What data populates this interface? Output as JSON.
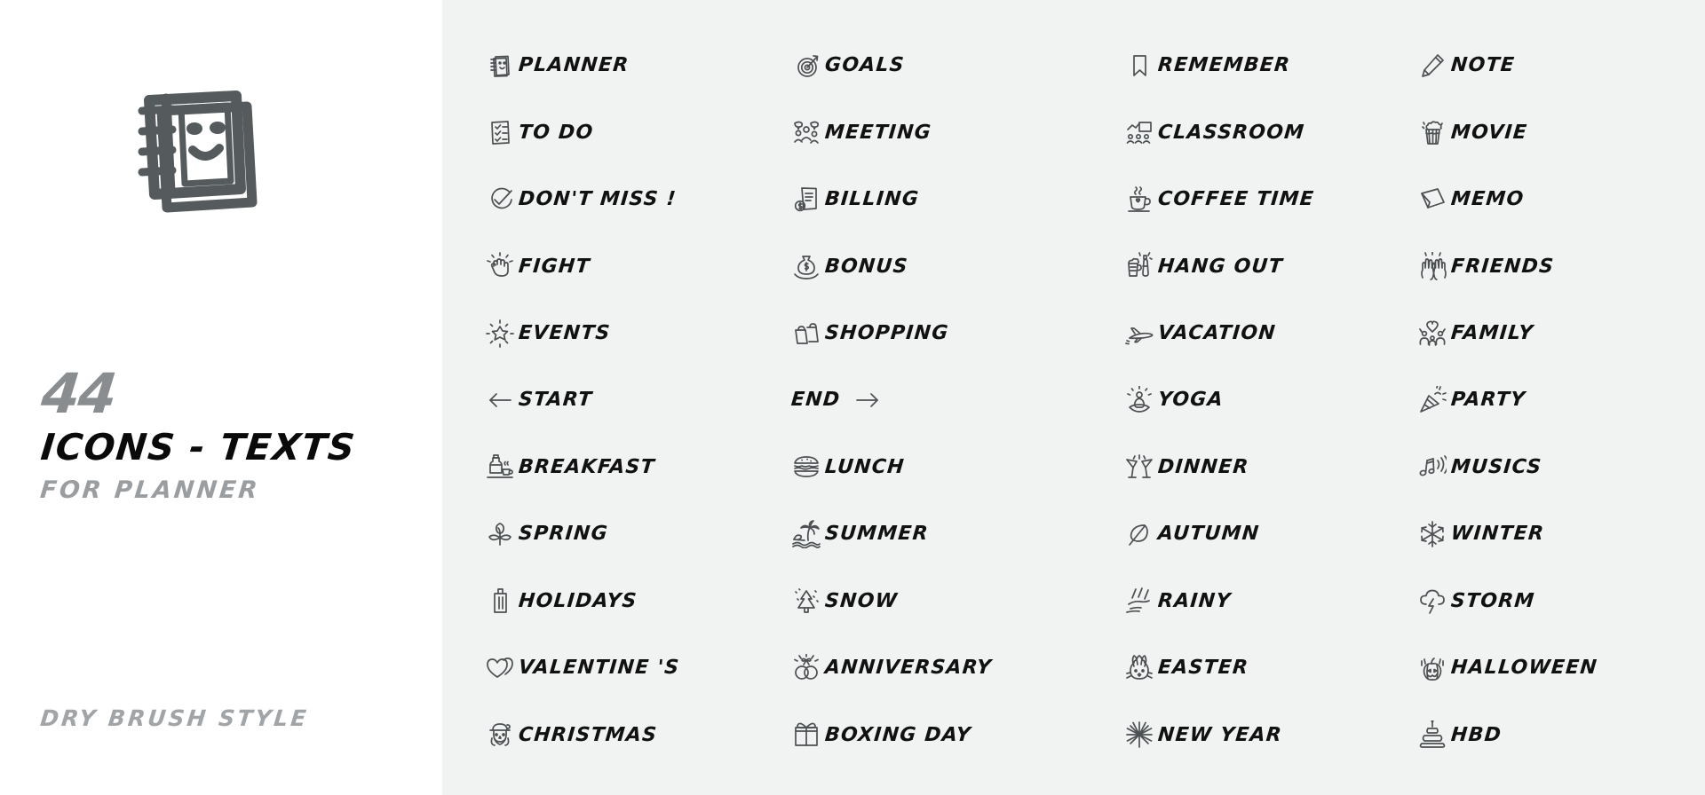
{
  "left": {
    "cover_icon": "notebook-smiley-icon",
    "count": "44",
    "title": "ICONS - TEXTS",
    "subtitle": "FOR PLANNER",
    "footnote": "DRY BRUSH STYLE"
  },
  "colors": {
    "left_background": "#ffffff",
    "right_background": "#f1f2f2",
    "icon_stroke": "#4c5052",
    "text": "#111111",
    "muted_text": "#9b9ea1",
    "count_text": "#8a8d90"
  },
  "grid": {
    "columns": 4,
    "rows": 11,
    "items": [
      {
        "label": "PLANNER",
        "icon": "notebook-icon",
        "icon_position": "leading"
      },
      {
        "label": "GOALS",
        "icon": "target-arrow-icon",
        "icon_position": "leading"
      },
      {
        "label": "REMEMBER",
        "icon": "bookmark-icon",
        "icon_position": "leading"
      },
      {
        "label": "NOTE",
        "icon": "pencil-icon",
        "icon_position": "leading"
      },
      {
        "label": "TO DO",
        "icon": "checklist-icon",
        "icon_position": "leading"
      },
      {
        "label": "MEETING",
        "icon": "people-talking-icon",
        "icon_position": "leading"
      },
      {
        "label": "CLASSROOM",
        "icon": "whiteboard-class-icon",
        "icon_position": "leading"
      },
      {
        "label": "MOVIE",
        "icon": "popcorn-icon",
        "icon_position": "leading"
      },
      {
        "label": "DON'T MISS !",
        "icon": "check-circle-icon",
        "icon_position": "leading"
      },
      {
        "label": "BILLING",
        "icon": "invoice-dollar-icon",
        "icon_position": "leading"
      },
      {
        "label": "COFFEE TIME",
        "icon": "coffee-cup-icon",
        "icon_position": "leading"
      },
      {
        "label": "MEMO",
        "icon": "sticky-note-icon",
        "icon_position": "leading"
      },
      {
        "label": "FIGHT",
        "icon": "raised-fist-icon",
        "icon_position": "leading"
      },
      {
        "label": "BONUS",
        "icon": "money-bag-hand-icon",
        "icon_position": "leading"
      },
      {
        "label": "HANG OUT",
        "icon": "beer-cheers-icon",
        "icon_position": "leading"
      },
      {
        "label": "FRIENDS",
        "icon": "high-five-hands-icon",
        "icon_position": "leading"
      },
      {
        "label": "EVENTS",
        "icon": "sparkle-star-icon",
        "icon_position": "leading"
      },
      {
        "label": "SHOPPING",
        "icon": "shopping-bags-icon",
        "icon_position": "leading"
      },
      {
        "label": "VACATION",
        "icon": "airplane-icon",
        "icon_position": "leading"
      },
      {
        "label": "FAMILY",
        "icon": "family-heart-icon",
        "icon_position": "leading"
      },
      {
        "label": "START",
        "icon": "arrow-left-icon",
        "icon_position": "leading"
      },
      {
        "label": "END",
        "icon": "arrow-right-icon",
        "icon_position": "trailing"
      },
      {
        "label": "YOGA",
        "icon": "meditation-icon",
        "icon_position": "leading"
      },
      {
        "label": "PARTY",
        "icon": "party-popper-icon",
        "icon_position": "leading"
      },
      {
        "label": "BREAKFAST",
        "icon": "breakfast-tray-icon",
        "icon_position": "leading"
      },
      {
        "label": "LUNCH",
        "icon": "burger-icon",
        "icon_position": "leading"
      },
      {
        "label": "DINNER",
        "icon": "cocktail-cheers-icon",
        "icon_position": "leading"
      },
      {
        "label": "MUSICS",
        "icon": "music-notes-icon",
        "icon_position": "leading"
      },
      {
        "label": "SPRING",
        "icon": "flower-icon",
        "icon_position": "leading"
      },
      {
        "label": "SUMMER",
        "icon": "beach-palm-icon",
        "icon_position": "leading"
      },
      {
        "label": "AUTUMN",
        "icon": "leaf-icon",
        "icon_position": "leading"
      },
      {
        "label": "WINTER",
        "icon": "snowflake-icon",
        "icon_position": "leading"
      },
      {
        "label": "HOLIDAYS",
        "icon": "suitcase-icon",
        "icon_position": "leading"
      },
      {
        "label": "SNOW",
        "icon": "snowy-tree-icon",
        "icon_position": "leading"
      },
      {
        "label": "RAINY",
        "icon": "rain-puddle-icon",
        "icon_position": "leading"
      },
      {
        "label": "STORM",
        "icon": "thunder-cloud-icon",
        "icon_position": "leading"
      },
      {
        "label": "VALENTINE 'S",
        "icon": "double-heart-icon",
        "icon_position": "leading"
      },
      {
        "label": "ANNIVERSARY",
        "icon": "wedding-rings-icon",
        "icon_position": "leading"
      },
      {
        "label": "EASTER",
        "icon": "easter-bunny-icon",
        "icon_position": "leading"
      },
      {
        "label": "HALLOWEEN",
        "icon": "pumpkin-icon",
        "icon_position": "leading"
      },
      {
        "label": "CHRISTMAS",
        "icon": "santa-icon",
        "icon_position": "leading"
      },
      {
        "label": "BOXING DAY",
        "icon": "gift-box-icon",
        "icon_position": "leading"
      },
      {
        "label": "NEW YEAR",
        "icon": "firework-icon",
        "icon_position": "leading"
      },
      {
        "label": "HBD",
        "icon": "birthday-cake-icon",
        "icon_position": "leading"
      }
    ]
  }
}
